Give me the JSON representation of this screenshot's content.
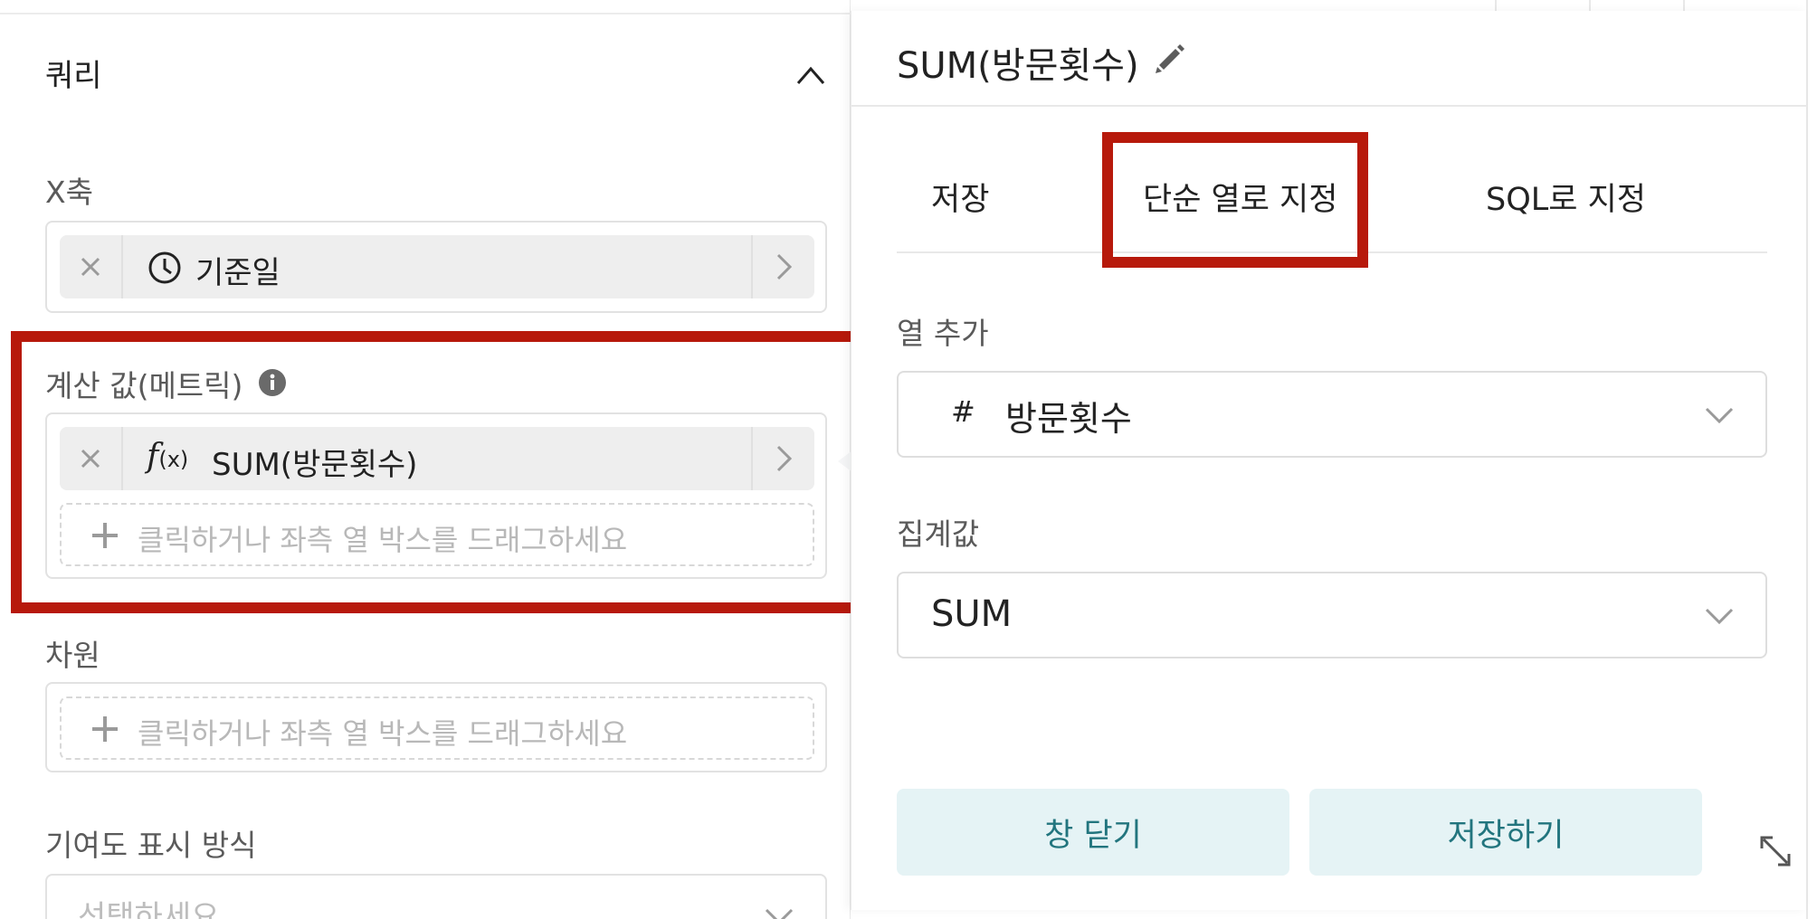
{
  "query_panel": {
    "title": "쿼리",
    "x_axis": {
      "label": "X축",
      "chip_label": "기준일"
    },
    "metric": {
      "label": "계산 값(메트릭)",
      "fx_symbol": "f",
      "fx_arg": "(x)",
      "chip_label": "SUM(방문횟수)",
      "drop_text": "클릭하거나 좌측 열 박스를 드래그하세요"
    },
    "dimension": {
      "label": "차원",
      "drop_text": "클릭하거나 좌측 열 박스를 드래그하세요"
    },
    "contribution": {
      "label": "기여도 표시 방식",
      "placeholder": "선택하세요"
    }
  },
  "metric_editor": {
    "title": "SUM(방문횟수)",
    "tabs": [
      {
        "label": "저장"
      },
      {
        "label": "단순 열로 지정"
      },
      {
        "label": "SQL로 지정"
      }
    ],
    "column_add": {
      "label": "열 추가",
      "type_symbol": "#",
      "value": "방문횟수"
    },
    "aggregate": {
      "label": "집계값",
      "value": "SUM"
    },
    "buttons": {
      "close": "창 닫기",
      "save": "저장하기"
    }
  },
  "colors": {
    "highlight": "#b7190b",
    "button_bg": "#e5f3f5",
    "button_text": "#22757e"
  }
}
